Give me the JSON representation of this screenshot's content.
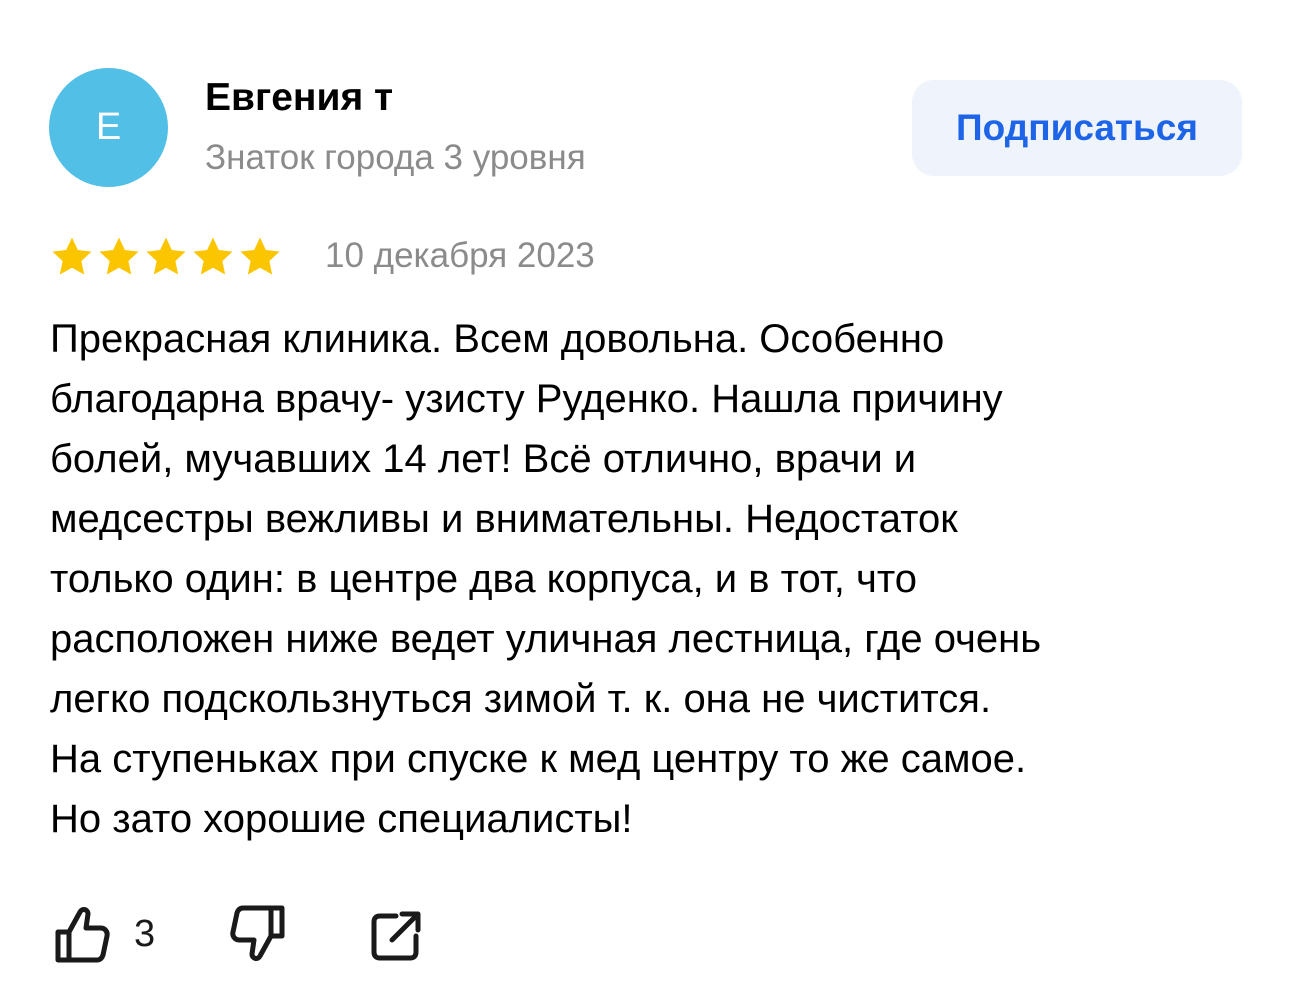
{
  "author": {
    "avatar_letter": "E",
    "avatar_color": "#52bfe6",
    "name": "Евгения т",
    "level": "Знаток города 3 уровня"
  },
  "subscribe_button": {
    "label": "Подписаться",
    "text_color": "#1d64e6",
    "background": "#eef3fc"
  },
  "review": {
    "rating": 5,
    "rating_max": 5,
    "star_color": "#fbc500",
    "date": "10 декабря 2023",
    "lines": [
      "Прекрасная клиника. Всем довольна. Особенно",
      "благодарна врачу- узисту Руденко. Нашла причину",
      "болей, мучавших 14 лет! Всё отлично, врачи и",
      "медсестры вежливы и внимательны. Недостаток",
      "только один: в центре два корпуса, и в тот, что",
      "расположен ниже ведет уличная лестница, где очень",
      "легко подскользнуться зимой т. к. она не чистится.",
      "На ступеньках при спуске к мед центру то же самое.",
      "Но зато хорошие специалисты!"
    ]
  },
  "actions": {
    "like_icon": "thumbs-up-icon",
    "like_count": "3",
    "dislike_icon": "thumbs-down-icon",
    "share_icon": "share-icon"
  }
}
